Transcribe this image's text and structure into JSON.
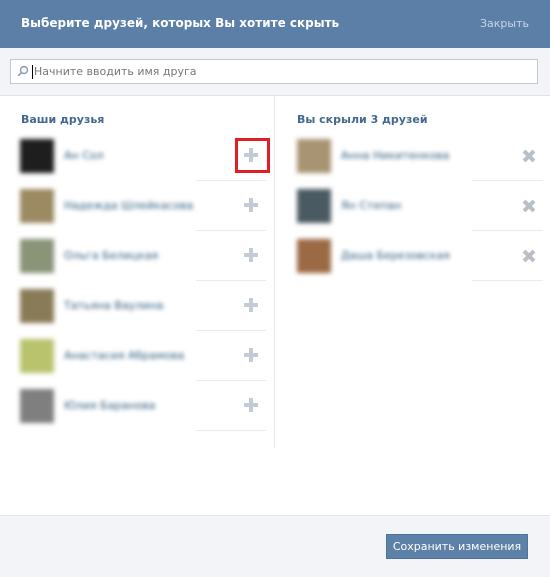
{
  "header": {
    "title": "Выберите друзей, которых Вы хотите скрыть",
    "close_label": "Закрыть"
  },
  "search": {
    "placeholder": "Начните вводить имя друга",
    "value": ""
  },
  "left_column": {
    "title": "Ваши друзья",
    "friends": [
      {
        "name": "Ан  Сол",
        "avatar_color": "#1e1e1e",
        "highlighted": true
      },
      {
        "name": "Надежда Шлейкасова",
        "avatar_color": "#9c8a63",
        "highlighted": false
      },
      {
        "name": "Ольга Белицкая",
        "avatar_color": "#8a9479",
        "highlighted": false
      },
      {
        "name": "Татьяна Ваулина",
        "avatar_color": "#8a7b58",
        "highlighted": false
      },
      {
        "name": "Анастасия Абрамова",
        "avatar_color": "#b9c36d",
        "highlighted": false
      },
      {
        "name": "Юлия Баранова",
        "avatar_color": "#7f7f7f",
        "highlighted": false
      }
    ]
  },
  "right_column": {
    "title": "Вы скрыли 3 друзей",
    "hidden_friends": [
      {
        "name": "Анна Никитенкова",
        "avatar_color": "#a89473"
      },
      {
        "name": "Ян  Степан",
        "avatar_color": "#4a5a62"
      },
      {
        "name": "Даша Березовская",
        "avatar_color": "#9b6a45"
      }
    ]
  },
  "footer": {
    "save_label": "Сохранить изменения"
  },
  "colors": {
    "header_bg": "#5b7fa6",
    "accent_link": "#45688e",
    "highlight": "#e01e24",
    "button_bg": "#5e81a8"
  },
  "icons": {
    "search": "magnifier-icon",
    "add": "plus-icon",
    "remove": "cross-icon"
  }
}
